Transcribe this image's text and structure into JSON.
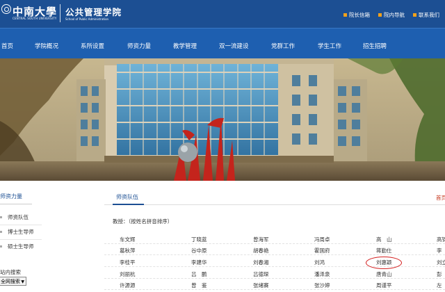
{
  "header": {
    "logo_cn": "中南大學",
    "logo_en": "CENTRAL SOUTH UNIVERSITY",
    "school_cn": "公共管理学院",
    "school_en": "School of Public Administration",
    "links": [
      "院长信箱",
      "院内导航",
      "联系我们"
    ]
  },
  "nav": {
    "items": [
      "首页",
      "学院概况",
      "系所设置",
      "师资力量",
      "教学管理",
      "双一流建设",
      "党群工作",
      "学生工作",
      "招生招聘"
    ]
  },
  "sidebar": {
    "title": "师资力量",
    "items": [
      "师资队伍",
      "博士生导师",
      "硕士生导师"
    ],
    "search_label": "站内搜索",
    "search_value": "全网搜索"
  },
  "main": {
    "tab": "师资队伍",
    "breadcrumb_home": "首页",
    "group_title": "教授：（按姓名拼音排序）",
    "rows": [
      [
        "车文辉",
        "丁晓蓝",
        "曾海军",
        "冯周卓",
        "高　山",
        "高锦"
      ],
      [
        "葛秋萍",
        "谷中原",
        "胡春艳",
        "霍国府",
        "蒋勤仕",
        "李　"
      ],
      [
        "李桂平",
        "李建华",
        "刘春湘",
        "刘鸿",
        "刘惠颖",
        "刘立"
      ],
      [
        "刘丽杭",
        "吕　鹏",
        "吕德琛",
        "潘泽泉",
        "唐青山",
        "彭"
      ],
      [
        "许源源",
        "曾　鉴",
        "张绪赛",
        "张沙婷",
        "周谨平",
        "左"
      ]
    ]
  },
  "colors": {
    "header_bg": "#1c4f93",
    "nav_bg": "#1e5fb0",
    "accent_orange": "#f2a11a",
    "highlight_red": "#d42020"
  }
}
